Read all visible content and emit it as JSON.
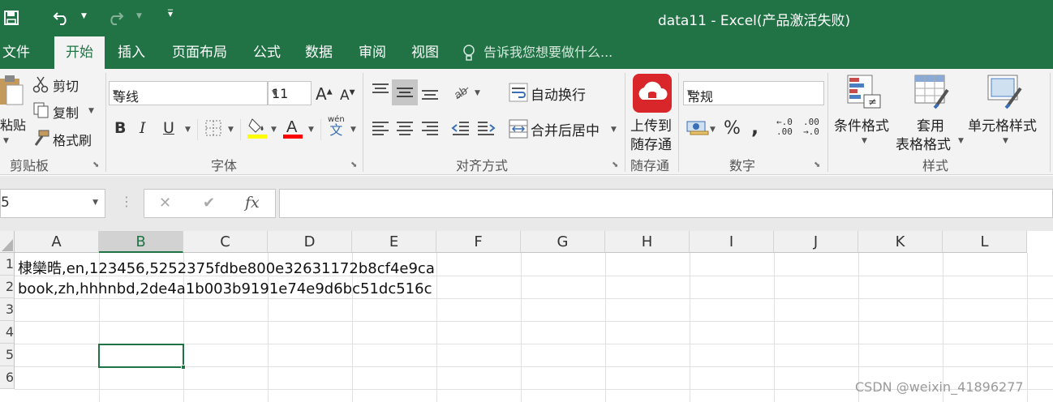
{
  "title": "data11 - Excel(产品激活失败)",
  "quick_access": {
    "save_icon": "save-icon",
    "undo_icon": "undo-icon",
    "redo_icon": "redo-icon",
    "customize_icon": "customize-icon"
  },
  "tabs": [
    "文件",
    "开始",
    "插入",
    "页面布局",
    "公式",
    "数据",
    "审阅",
    "视图"
  ],
  "active_tab": "开始",
  "tell_me": "告诉我您想要做什么...",
  "ribbon": {
    "clipboard": {
      "paste": "粘贴",
      "cut": "剪切",
      "copy": "复制",
      "format_painter": "格式刷",
      "label": "剪贴板"
    },
    "font": {
      "name": "等线",
      "size": "11",
      "bold": "B",
      "italic": "I",
      "underline": "U",
      "pinyin": "wén",
      "pinyin_char": "文",
      "label": "字体",
      "fill_color": "#ffff00",
      "font_color": "#ff0000"
    },
    "alignment": {
      "wrap": "自动换行",
      "merge": "合并后居中",
      "label": "对齐方式"
    },
    "save_to_cloud": {
      "line1": "上传到",
      "line2": "随存通",
      "label": "随存通"
    },
    "number": {
      "format": "常规",
      "percent": "%",
      "comma": ",",
      "inc_decimal": "←.0\n.00",
      "dec_decimal": ".00\n→.0",
      "label": "数字"
    },
    "styles": {
      "conditional": "条件格式",
      "as_table_1": "套用",
      "as_table_2": "表格格式",
      "cell_styles": "单元格样式",
      "label": "样式"
    }
  },
  "formula_bar": {
    "name_box": "5",
    "cancel": "✕",
    "enter": "✔",
    "fx": "fx",
    "value": ""
  },
  "columns": [
    "A",
    "B",
    "C",
    "D",
    "E",
    "F",
    "G",
    "H",
    "I",
    "J",
    "K",
    "L"
  ],
  "selected_column": "B",
  "rows": [
    "1",
    "2",
    "3",
    "4",
    "5",
    "6"
  ],
  "cells": {
    "A1": "棣欒晧,en,123456,5252375fdbe800e32631172b8cf4e9ca",
    "A2": "book,zh,hhhnbd,2de4a1b003b9191e74e9d6bc51dc516c"
  },
  "watermark": "CSDN @weixin_41896277",
  "colors": {
    "accent": "#217346"
  }
}
